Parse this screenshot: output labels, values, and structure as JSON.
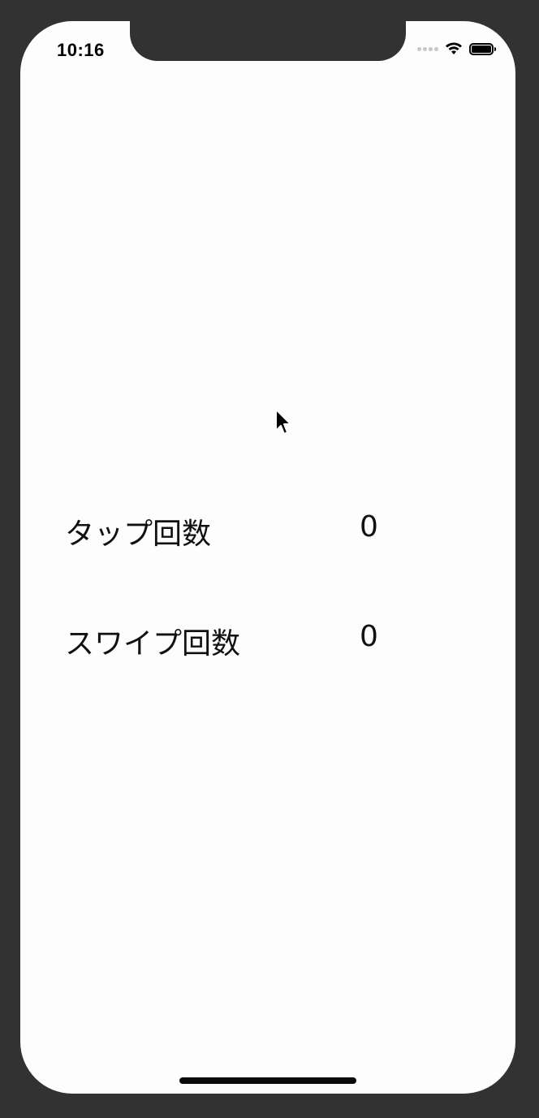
{
  "status_bar": {
    "time": "10:16"
  },
  "counters": {
    "tap": {
      "label": "タップ回数",
      "value": "0"
    },
    "swipe": {
      "label": "スワイプ回数",
      "value": "0"
    }
  },
  "icons": [
    "wifi-icon",
    "battery-icon",
    "signal-icon",
    "cursor-icon"
  ]
}
